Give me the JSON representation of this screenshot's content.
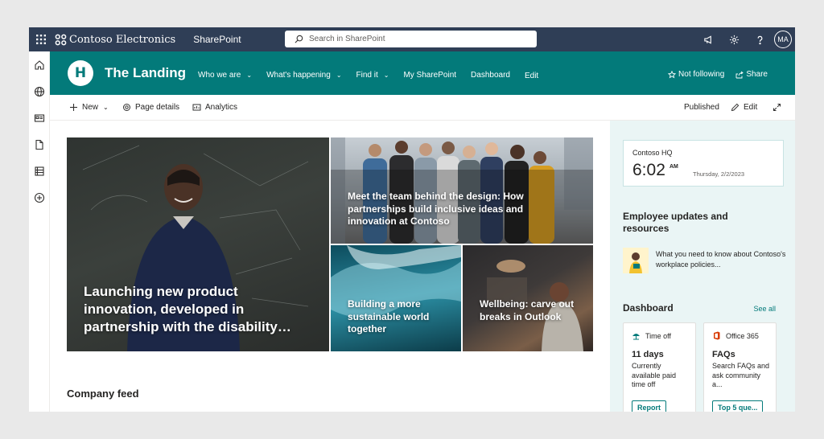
{
  "suitebar": {
    "brand": "Contoso Electronics",
    "app_name": "SharePoint",
    "search_placeholder": "Search in SharePoint",
    "user_initials": "MA",
    "icons": [
      "waffle-icon",
      "megaphone-icon",
      "gear-icon",
      "help-icon"
    ]
  },
  "rail": {
    "icons": [
      "home-icon",
      "globe-icon",
      "news-icon",
      "document-icon",
      "list-icon",
      "add-icon"
    ]
  },
  "site": {
    "logo_letter": "H",
    "title": "The Landing",
    "nav": [
      {
        "label": "Who we are",
        "dropdown": true
      },
      {
        "label": "What's happening",
        "dropdown": true
      },
      {
        "label": "Find it",
        "dropdown": true
      },
      {
        "label": "My SharePoint",
        "dropdown": false
      },
      {
        "label": "Dashboard",
        "dropdown": false
      },
      {
        "label": "Edit",
        "dropdown": false
      }
    ],
    "follow_label": "Not following",
    "share_label": "Share",
    "accent_color": "#037a7a"
  },
  "commandbar": {
    "new_label": "New",
    "page_details_label": "Page details",
    "analytics_label": "Analytics",
    "status": "Published",
    "edit_label": "Edit"
  },
  "hero": [
    {
      "caption": "Launching new product innovation, developed in partnership with the disability…"
    },
    {
      "caption": "Meet the team behind the design: How partnerships build inclusive ideas and innovation at Contoso"
    },
    {
      "caption": "Building a more sustainable world together"
    },
    {
      "caption": "Wellbeing: carve out breaks in Outlook"
    }
  ],
  "feed": {
    "title": "Company feed"
  },
  "clock": {
    "location": "Contoso HQ",
    "time": "6:02",
    "ampm": "AM",
    "date": "Thursday, 2/2/2023"
  },
  "updates": {
    "title": "Employee updates and resources",
    "item_text": "What you need to know about Contoso's workplace policies..."
  },
  "dashboard": {
    "title": "Dashboard",
    "see_all": "See all",
    "cards": [
      {
        "app": "Time off",
        "value": "11 days",
        "description": "Currently available paid time off",
        "button": "Report"
      },
      {
        "app": "Office 365",
        "value": "FAQs",
        "description": "Search FAQs and ask community a...",
        "button": "Top 5 que..."
      }
    ]
  }
}
